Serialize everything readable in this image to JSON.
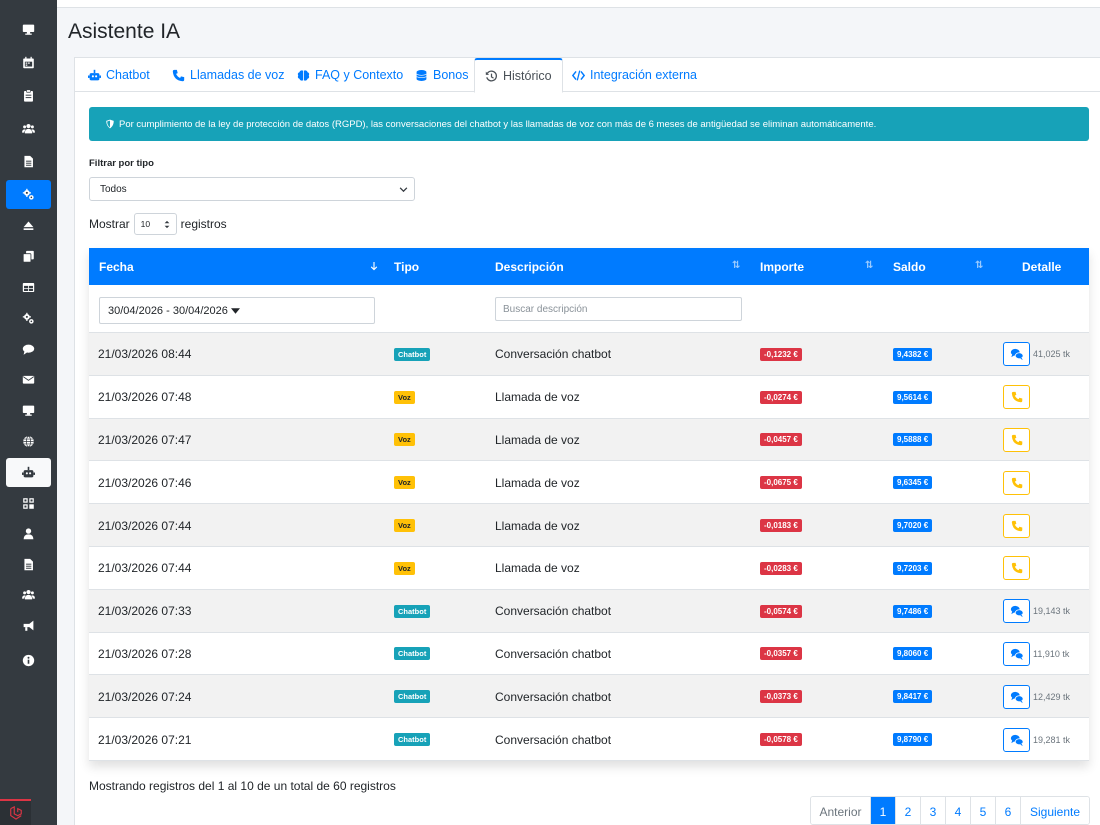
{
  "page": {
    "title": "Asistente IA"
  },
  "tabs": [
    {
      "label": "Chatbot",
      "icon": "robot-icon"
    },
    {
      "label": "Llamadas de voz",
      "icon": "phone-icon"
    },
    {
      "label": "FAQ y Contexto",
      "icon": "brain-icon"
    },
    {
      "label": "Bonos",
      "icon": "coins-icon"
    },
    {
      "label": "Histórico",
      "icon": "history-icon"
    },
    {
      "label": "Integración externa",
      "icon": "code-icon"
    }
  ],
  "alert": {
    "text": "Por cumplimiento de la ley de protección de datos (RGPD), las conversaciones del chatbot y las llamadas de voz con más de 6 meses de antigüedad se eliminan automáticamente."
  },
  "filter": {
    "label": "Filtrar por tipo",
    "value": "Todos"
  },
  "length": {
    "prefix": "Mostrar",
    "value": "10",
    "suffix": "registros"
  },
  "table": {
    "headers": {
      "fecha": "Fecha",
      "tipo": "Tipo",
      "descripcion": "Descripción",
      "importe": "Importe",
      "saldo": "Saldo",
      "detalle": "Detalle"
    },
    "date_filter": "30/04/2026 - 30/04/2026",
    "desc_placeholder": "Buscar descripción",
    "rows": [
      {
        "fecha": "21/03/2026 08:44",
        "tipo": "Chatbot",
        "descripcion": "Conversación chatbot",
        "importe": "-0,1232 €",
        "saldo": "9,4382 €",
        "tokens": "41,025 tk"
      },
      {
        "fecha": "21/03/2026 07:48",
        "tipo": "Voz",
        "descripcion": "Llamada de voz",
        "importe": "-0,0274 €",
        "saldo": "9,5614 €",
        "tokens": ""
      },
      {
        "fecha": "21/03/2026 07:47",
        "tipo": "Voz",
        "descripcion": "Llamada de voz",
        "importe": "-0,0457 €",
        "saldo": "9,5888 €",
        "tokens": ""
      },
      {
        "fecha": "21/03/2026 07:46",
        "tipo": "Voz",
        "descripcion": "Llamada de voz",
        "importe": "-0,0675 €",
        "saldo": "9,6345 €",
        "tokens": ""
      },
      {
        "fecha": "21/03/2026 07:44",
        "tipo": "Voz",
        "descripcion": "Llamada de voz",
        "importe": "-0,0183 €",
        "saldo": "9,7020 €",
        "tokens": ""
      },
      {
        "fecha": "21/03/2026 07:44",
        "tipo": "Voz",
        "descripcion": "Llamada de voz",
        "importe": "-0,0283 €",
        "saldo": "9,7203 €",
        "tokens": ""
      },
      {
        "fecha": "21/03/2026 07:33",
        "tipo": "Chatbot",
        "descripcion": "Conversación chatbot",
        "importe": "-0,0574 €",
        "saldo": "9,7486 €",
        "tokens": "19,143 tk"
      },
      {
        "fecha": "21/03/2026 07:28",
        "tipo": "Chatbot",
        "descripcion": "Conversación chatbot",
        "importe": "-0,0357 €",
        "saldo": "9,8060 €",
        "tokens": "11,910 tk"
      },
      {
        "fecha": "21/03/2026 07:24",
        "tipo": "Chatbot",
        "descripcion": "Conversación chatbot",
        "importe": "-0,0373 €",
        "saldo": "9,8417 €",
        "tokens": "12,429 tk"
      },
      {
        "fecha": "21/03/2026 07:21",
        "tipo": "Chatbot",
        "descripcion": "Conversación chatbot",
        "importe": "-0,0578 €",
        "saldo": "9,8790 €",
        "tokens": "19,281 tk"
      }
    ]
  },
  "info": "Mostrando registros del 1 al 10 de un total de 60 registros",
  "pagination": {
    "prev": "Anterior",
    "pages": [
      "1",
      "2",
      "3",
      "4",
      "5",
      "6"
    ],
    "next": "Siguiente",
    "active": "1"
  },
  "sidebar": {
    "icons": [
      "monitor-icon",
      "calendar-icon",
      "clipboard-icon",
      "users-icon",
      "file-icon",
      "cogs-icon",
      "eject-icon",
      "copy-icon",
      "table-icon",
      "cogs-icon",
      "comment-icon",
      "envelope-icon",
      "desktop-icon",
      "globe-icon",
      "robot-icon",
      "grid-icon",
      "user-icon",
      "file-icon",
      "users-icon",
      "bullhorn-icon",
      "info-icon"
    ]
  },
  "colors": {
    "primary": "#007bff",
    "info": "#17a2b8",
    "warning": "#ffc107",
    "danger": "#dc3545",
    "sidebar": "#343a40"
  }
}
